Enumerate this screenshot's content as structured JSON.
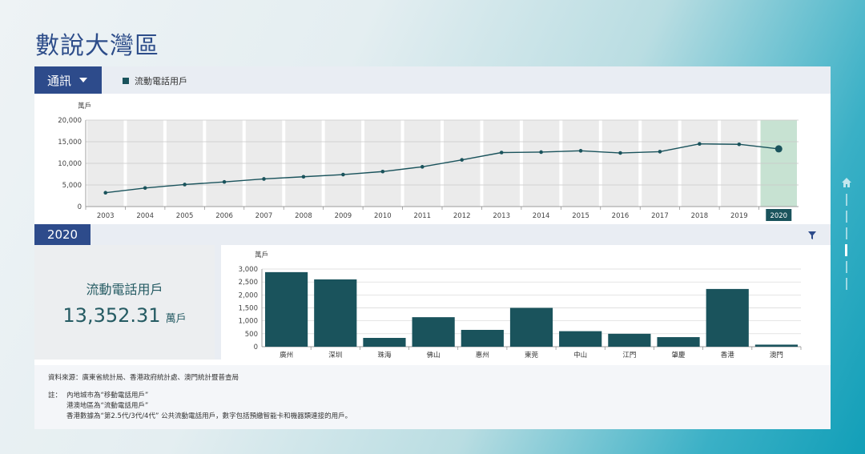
{
  "page": {
    "title": "數說大灣區"
  },
  "top_bar": {
    "category": "通訊",
    "legend_label": "流動電話用戶"
  },
  "section": {
    "year": "2020"
  },
  "stat": {
    "label": "流動電話用戶",
    "value": "13,352.31",
    "unit": "萬戶"
  },
  "source": "資料來源：廣東省統計局、香港政府統計處、澳門統計暨普查局",
  "notes": {
    "head": "註：",
    "lines": [
      "內地城市為“移動電話用戶”",
      "港澳地區為“流動電話用戶”",
      "香港數據為“第2.5代/3代/4代” 公共流動電話用戶，數字包括預繳智能卡和機器類連接的用戶。"
    ]
  },
  "colors": {
    "brand": "#2d4b8b",
    "series": "#1a535c",
    "highlight": "#c7e2d2",
    "column_bg": "#ebebeb"
  },
  "icons": {
    "category_caret": "chevron-down-icon",
    "filter": "filter-icon",
    "side_home": "home-icon"
  },
  "chart_data": [
    {
      "type": "line",
      "title": "",
      "ylabel": "萬戶",
      "xlabel": "",
      "x": [
        "2003",
        "2004",
        "2005",
        "2006",
        "2007",
        "2008",
        "2009",
        "2010",
        "2011",
        "2012",
        "2013",
        "2014",
        "2015",
        "2016",
        "2017",
        "2018",
        "2019",
        "2020"
      ],
      "series": [
        {
          "name": "流動電話用戶",
          "values": [
            3200,
            4300,
            5100,
            5700,
            6400,
            6900,
            7400,
            8100,
            9200,
            10800,
            12500,
            12600,
            12900,
            12400,
            12700,
            14500,
            14400,
            13352.31
          ]
        }
      ],
      "ylim": [
        0,
        20000
      ],
      "yticks": [
        0,
        5000,
        10000,
        15000,
        20000
      ],
      "ytick_labels": [
        "0",
        "5,000",
        "10,000",
        "15,000",
        "20,000"
      ],
      "selected": "2020",
      "grid": true
    },
    {
      "type": "bar",
      "title": "",
      "ylabel": "萬戶",
      "xlabel": "",
      "categories": [
        "廣州",
        "深圳",
        "珠海",
        "佛山",
        "惠州",
        "東莞",
        "中山",
        "江門",
        "肇慶",
        "香港",
        "澳門"
      ],
      "values": [
        2880,
        2600,
        340,
        1140,
        650,
        1500,
        600,
        500,
        370,
        2230,
        80
      ],
      "ylim": [
        0,
        3000
      ],
      "yticks": [
        0,
        500,
        1000,
        1500,
        2000,
        2500,
        3000
      ],
      "ytick_labels": [
        "0",
        "500",
        "1,000",
        "1,500",
        "2,000",
        "2,500",
        "3,000"
      ],
      "grid": true
    }
  ]
}
